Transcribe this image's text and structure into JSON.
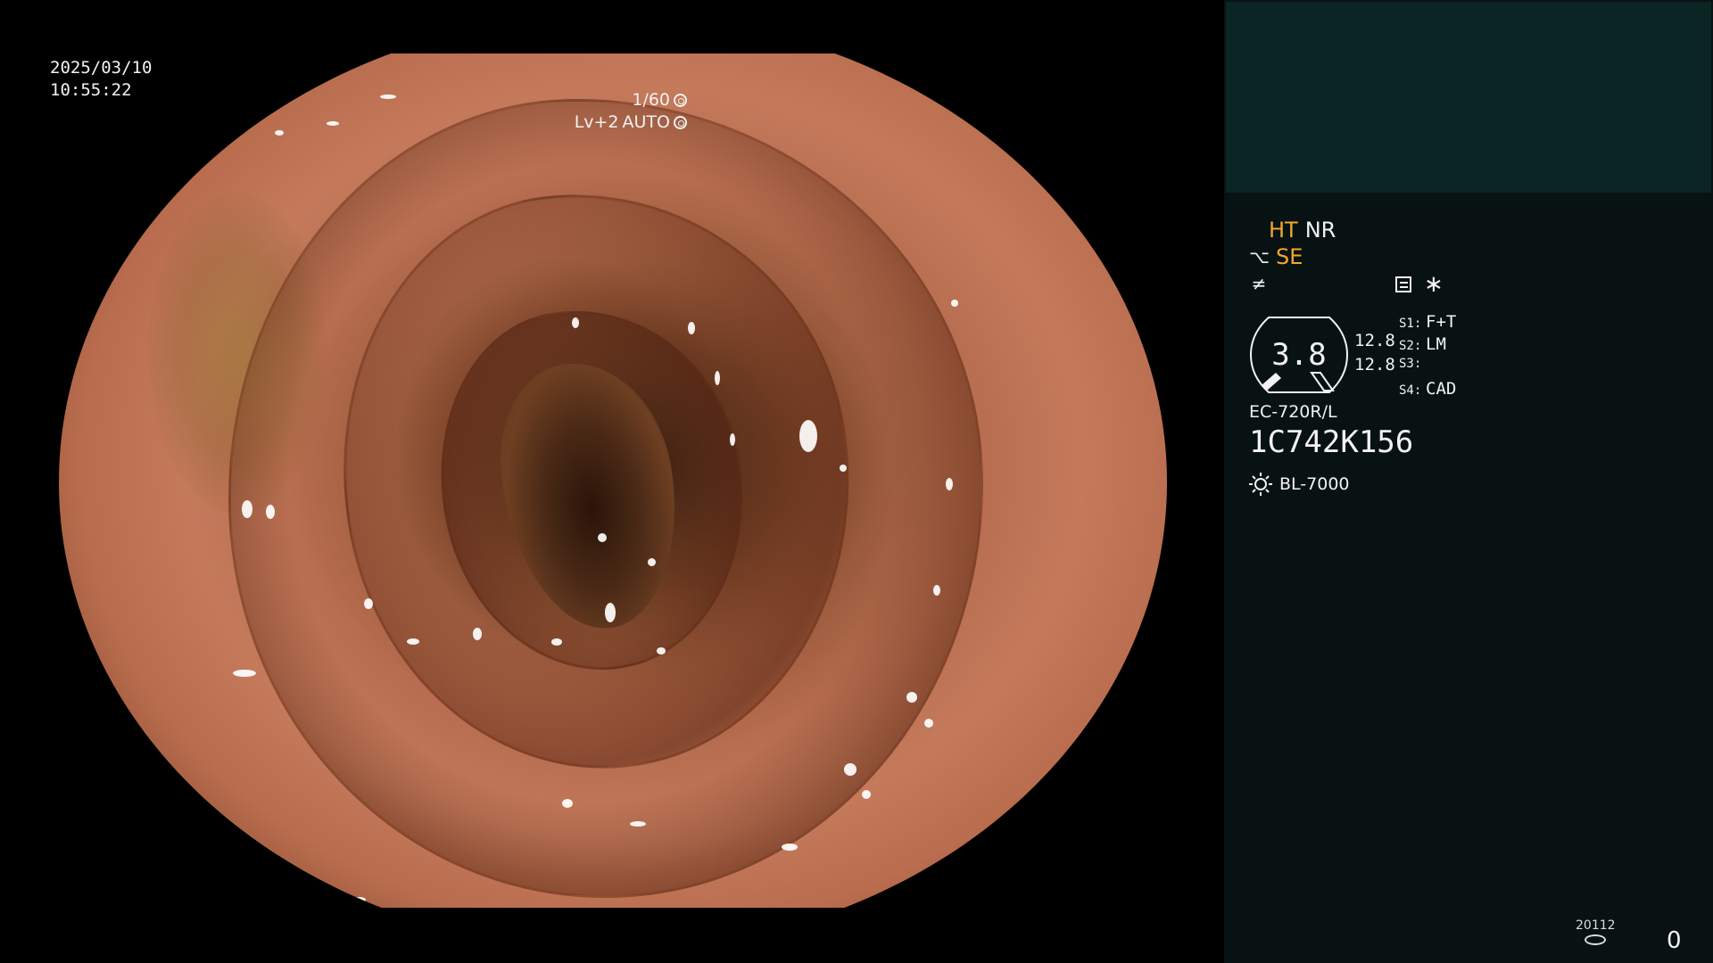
{
  "overlay": {
    "date": "2025/03/10",
    "time": "10:55:22",
    "shutter": "1/60",
    "level": "Lv+2",
    "iris": "AUTO",
    "shutter_icon": "aperture-icon",
    "iris_icon": "iris-icon"
  },
  "panel": {
    "modes": {
      "ht": "HT",
      "nr": "NR",
      "se": "SE"
    },
    "gauge": {
      "value": "3.8",
      "side_top": "12.8",
      "side_bottom": "12.8"
    },
    "switches": [
      {
        "key": "S1:",
        "value": "F+T"
      },
      {
        "key": "S2:",
        "value": "LM"
      },
      {
        "key": "S3:",
        "value": ""
      },
      {
        "key": "S4:",
        "value": "CAD"
      }
    ],
    "scope_model": "EC-720R/L",
    "scope_serial": "1C742K156",
    "light_source": "BL-7000",
    "footer_counter": "20112",
    "footer_index": "0"
  },
  "colors": {
    "panel_bg": "#081212",
    "panel_top_bg": "#0b2424",
    "accent_amber": "#f0a830",
    "text": "#f2f2f2"
  }
}
